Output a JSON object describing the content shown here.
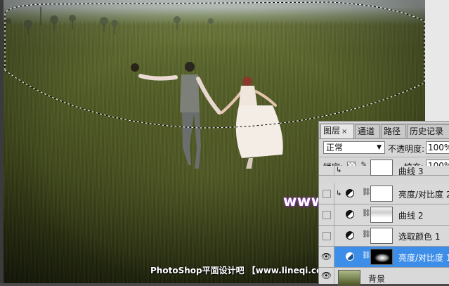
{
  "panel": {
    "tabs": [
      {
        "label": "图层",
        "close": "×",
        "active": true
      },
      {
        "label": "通道",
        "active": false
      },
      {
        "label": "路径",
        "active": false
      },
      {
        "label": "历史记录",
        "active": false
      }
    ],
    "blend_mode": "正常",
    "opacity_label": "不透明度:",
    "opacity_value": "100%",
    "lock_label": "锁定:",
    "fill_label": "填充:",
    "fill_value": "100%",
    "lock_icons": [
      "checkerboard-lock-icon",
      "brush-lock-icon",
      "move-lock-icon",
      "padlock-icon"
    ],
    "layers": [
      {
        "name": "曲线 3",
        "visible": false,
        "clipped": true,
        "type": "adjustment",
        "mask": "white"
      },
      {
        "name": "亮度/对比度 2",
        "visible": false,
        "clipped": true,
        "type": "adjustment",
        "mask": "white"
      },
      {
        "name": "曲线 2",
        "visible": false,
        "clipped": false,
        "type": "adjustment",
        "mask": "curve2"
      },
      {
        "name": "选取颜色 1",
        "visible": false,
        "clipped": false,
        "type": "adjustment",
        "mask": "white"
      },
      {
        "name": "亮度/对比度 1",
        "visible": true,
        "clipped": false,
        "type": "adjustment",
        "mask": "black-glow",
        "selected": true
      },
      {
        "name": "背景",
        "visible": true,
        "clipped": false,
        "type": "photo"
      }
    ]
  },
  "watermarks": {
    "site": "www.68ps.com",
    "footer": "PhotoShop平面设计吧 【www.lineqi.com/tieba/1783】"
  },
  "colors": {
    "selected_layer": "#3d8ee8",
    "watermark_glow": "#8c3fb3"
  }
}
